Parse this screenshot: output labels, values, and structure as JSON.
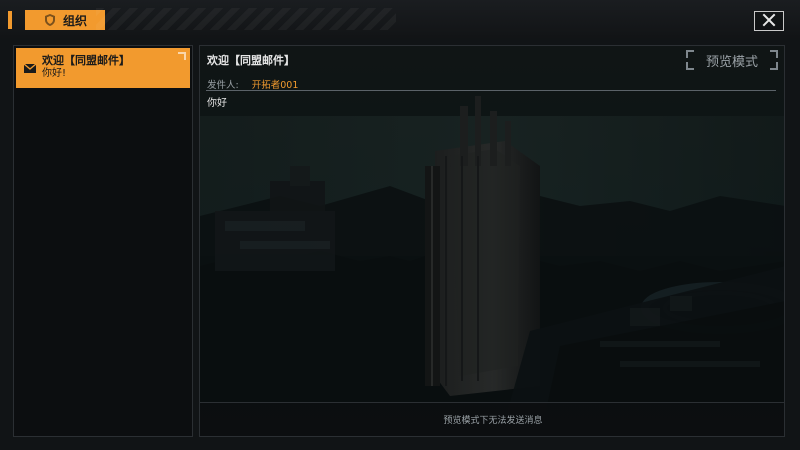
{
  "window": {
    "title": "组织",
    "icons": {
      "title": "guild-shield-icon",
      "close": "close-icon"
    }
  },
  "mail_list": {
    "items": [
      {
        "title": "欢迎【同盟邮件】",
        "snippet": "你好!",
        "selected": true,
        "icon": "mail-icon"
      }
    ]
  },
  "message": {
    "subject": "欢迎【同盟邮件】",
    "mode_badge": "预览模式",
    "sender_label": "发件人:",
    "sender_name": "开拓者001",
    "body": "你好",
    "footer_notice": "预览模式下无法发送消息"
  },
  "theme": {
    "accent": "#f29a2e",
    "panel_border": "#2b2f33",
    "text_primary": "#e6e6e6",
    "text_muted": "#9aa1a6"
  }
}
